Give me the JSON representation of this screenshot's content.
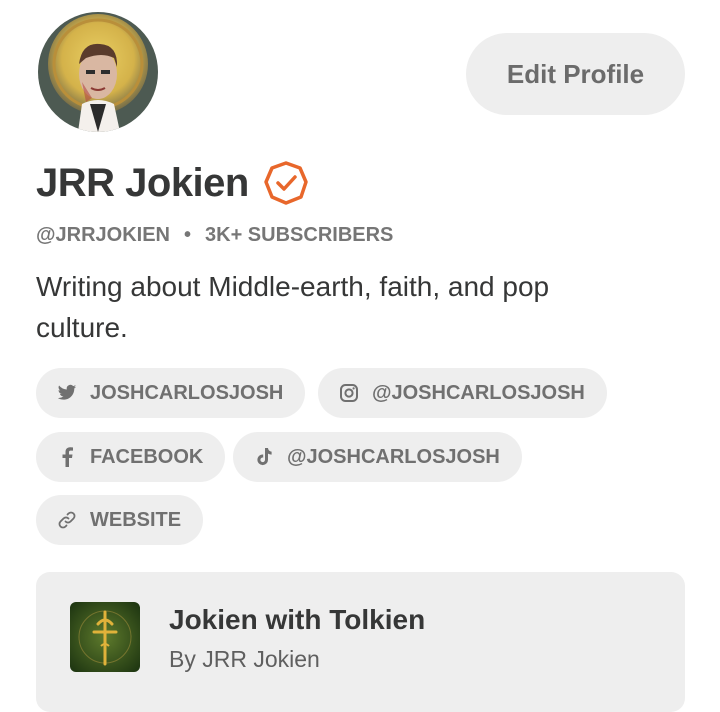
{
  "profile": {
    "avatar_alt": "profile-avatar",
    "edit_label": "Edit Profile",
    "name": "JRR Jokien",
    "verified_icon": "verified-badge-icon",
    "handle": "@JRRJOKIEN",
    "separator": "•",
    "subscribers": "3K+ SUBSCRIBERS",
    "bio": "Writing about Middle-earth, faith, and pop culture."
  },
  "links": [
    {
      "icon": "twitter-icon",
      "label": "JOSHCARLOSJOSH"
    },
    {
      "icon": "instagram-icon",
      "label": "@JOSHCARLOSJOSH"
    },
    {
      "icon": "facebook-icon",
      "label": "FACEBOOK"
    },
    {
      "icon": "tiktok-icon",
      "label": "@JOSHCARLOSJOSH"
    },
    {
      "icon": "link-icon",
      "label": "WEBSITE"
    }
  ],
  "publication": {
    "title": "Jokien with Tolkien",
    "byline": "By JRR Jokien"
  },
  "colors": {
    "accent": "#e8672b",
    "chip_bg": "#eeeeee",
    "text": "#363737",
    "muted": "#767676"
  }
}
